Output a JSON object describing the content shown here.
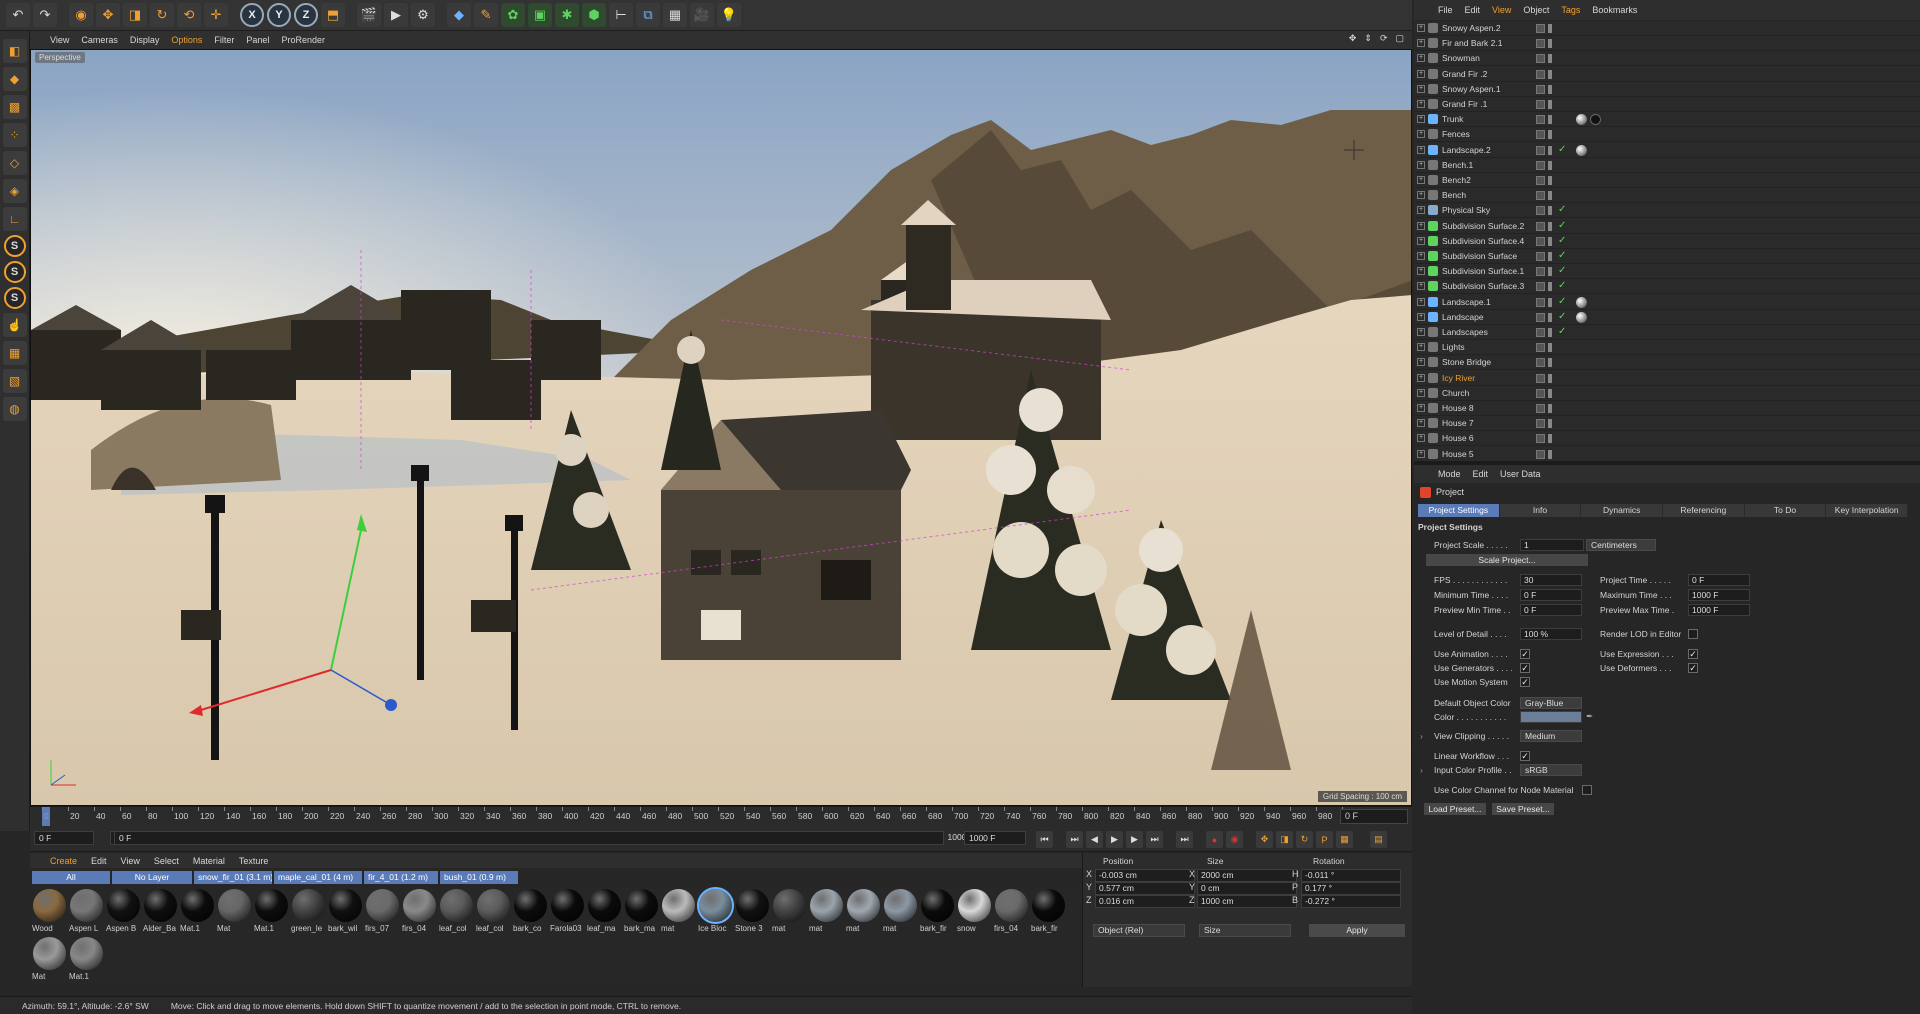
{
  "top_menu": {
    "file": "File",
    "edit": "Edit",
    "view": "View",
    "object": "Object",
    "tags": "Tags",
    "bookmarks": "Bookmarks"
  },
  "toolbar": {
    "x_axis": "X",
    "y_axis": "Y",
    "z_axis": "Z"
  },
  "viewport": {
    "menu": {
      "view": "View",
      "cameras": "Cameras",
      "display": "Display",
      "options": "Options",
      "filter": "Filter",
      "panel": "Panel",
      "prorender": "ProRender"
    },
    "label": "Perspective",
    "grid_spacing": "Grid Spacing : 100 cm"
  },
  "timeline": {
    "ticks": [
      "0",
      "20",
      "40",
      "60",
      "80",
      "100",
      "120",
      "140",
      "160",
      "180",
      "200",
      "220",
      "240",
      "260",
      "280",
      "300",
      "320",
      "340",
      "360",
      "380",
      "400",
      "420",
      "440",
      "460",
      "480",
      "500",
      "520",
      "540",
      "560",
      "580",
      "600",
      "620",
      "640",
      "660",
      "680",
      "700",
      "720",
      "740",
      "760",
      "780",
      "800",
      "820",
      "840",
      "860",
      "880",
      "900",
      "920",
      "940",
      "960",
      "980",
      "1000"
    ],
    "current_frame": "0 F",
    "start": "0 F",
    "start2": "0 F",
    "end": "1000 F",
    "end2": "1000 F"
  },
  "material_manager": {
    "menu": {
      "create": "Create",
      "edit": "Edit",
      "view": "View",
      "select": "Select",
      "material": "Material",
      "texture": "Texture"
    },
    "layers": [
      "All",
      "No Layer",
      "snow_fir_01 (3.1 m)",
      "maple_cal_01 (4 m)",
      "fir_4_01 (1.2 m)",
      "bush_01 (0.9 m)"
    ],
    "materials": [
      {
        "name": "Wood",
        "color": "#8a6a40"
      },
      {
        "name": "Aspen L",
        "color": "#777"
      },
      {
        "name": "Aspen B",
        "color": "#111"
      },
      {
        "name": "Alder_Ba",
        "color": "#0e0e0e"
      },
      {
        "name": "Mat.1",
        "color": "#0c0c0c"
      },
      {
        "name": "Mat",
        "color": "#666"
      },
      {
        "name": "Mat.1",
        "color": "#0d0d0d"
      },
      {
        "name": "green_le",
        "color": "#444"
      },
      {
        "name": "bark_wil",
        "color": "#101010"
      },
      {
        "name": "firs_07",
        "color": "#6a6a6a"
      },
      {
        "name": "firs_04",
        "color": "#8a8a8a"
      },
      {
        "name": "leaf_col",
        "color": "#5a5a5a"
      },
      {
        "name": "leaf_col",
        "color": "#5c5c5c"
      },
      {
        "name": "bark_co",
        "color": "#0c0c0c"
      },
      {
        "name": "Farola03",
        "color": "#0a0a0a"
      },
      {
        "name": "leaf_ma",
        "color": "#0b0b0b"
      },
      {
        "name": "bark_ma",
        "color": "#0c0c0c"
      },
      {
        "name": "mat",
        "color": "#bbbbbb"
      },
      {
        "name": "Ice Bloc",
        "color": "#7a8e9e"
      },
      {
        "name": "Stone 3",
        "color": "#111"
      },
      {
        "name": "mat",
        "color": "#444"
      },
      {
        "name": "mat",
        "color": "#9aa4ac"
      },
      {
        "name": "mat",
        "color": "#a0a8b0"
      },
      {
        "name": "mat",
        "color": "#8c98a4"
      },
      {
        "name": "bark_fir",
        "color": "#0b0b0b"
      },
      {
        "name": "snow",
        "color": "#d8d8d8"
      },
      {
        "name": "firs_04",
        "color": "#6a6a6a"
      },
      {
        "name": "bark_fir",
        "color": "#0a0a0a"
      },
      {
        "name": "Mat",
        "color": "#9a9a9a"
      },
      {
        "name": "Mat.1",
        "color": "#888"
      }
    ]
  },
  "coordinates": {
    "headers": {
      "position": "Position",
      "size": "Size",
      "rotation": "Rotation"
    },
    "rows": [
      {
        "axis": "X",
        "pos": "-0.003 cm",
        "size_axis": "X",
        "size": "2000 cm",
        "rot_axis": "H",
        "rot": "-0.011 °"
      },
      {
        "axis": "Y",
        "pos": "0.577 cm",
        "size_axis": "Y",
        "size": "0 cm",
        "rot_axis": "P",
        "rot": "0.177 °"
      },
      {
        "axis": "Z",
        "pos": "0.016 cm",
        "size_axis": "Z",
        "size": "1000 cm",
        "rot_axis": "B",
        "rot": "-0.272 °"
      }
    ],
    "mode": "Object (Rel)",
    "size_mode": "Size",
    "apply": "Apply"
  },
  "status": {
    "azimuth": "Azimuth: 59.1°, Altitude: -2.6°  SW",
    "message": "Move: Click and drag to move elements. Hold down SHIFT to quantize movement / add to the selection in point mode, CTRL to remove."
  },
  "objects": [
    {
      "name": "Snowy Aspen.2",
      "color": "#d4d4d4",
      "icon": "#777"
    },
    {
      "name": "Fir and Bark 2.1",
      "color": "#d4d4d4",
      "icon": "#777"
    },
    {
      "name": "Snowman",
      "color": "#d4d4d4",
      "icon": "#777"
    },
    {
      "name": "Grand Fir .2",
      "color": "#d4d4d4",
      "icon": "#777"
    },
    {
      "name": "Snowy Aspen.1",
      "color": "#d4d4d4",
      "icon": "#777"
    },
    {
      "name": "Grand Fir .1",
      "color": "#d4d4d4",
      "icon": "#777"
    },
    {
      "name": "Trunk",
      "color": "#d4d4d4",
      "icon": "#6cb4ff"
    },
    {
      "name": "Fences",
      "color": "#d4d4d4",
      "icon": "#777"
    },
    {
      "name": "Landscape.2",
      "color": "#d4d4d4",
      "icon": "#6cb4ff"
    },
    {
      "name": "Bench.1",
      "color": "#d4d4d4",
      "icon": "#777"
    },
    {
      "name": "Bench2",
      "color": "#d4d4d4",
      "icon": "#777"
    },
    {
      "name": "Bench",
      "color": "#d4d4d4",
      "icon": "#777"
    },
    {
      "name": "Physical Sky",
      "color": "#d4d4d4",
      "icon": "#8ac"
    },
    {
      "name": "Subdivision Surface.2",
      "color": "#d4d4d4",
      "icon": "#5fd35f"
    },
    {
      "name": "Subdivision Surface.4",
      "color": "#d4d4d4",
      "icon": "#5fd35f"
    },
    {
      "name": "Subdivision Surface",
      "color": "#d4d4d4",
      "icon": "#5fd35f"
    },
    {
      "name": "Subdivision Surface.1",
      "color": "#d4d4d4",
      "icon": "#5fd35f"
    },
    {
      "name": "Subdivision Surface.3",
      "color": "#d4d4d4",
      "icon": "#5fd35f"
    },
    {
      "name": "Landscape.1",
      "color": "#d4d4d4",
      "icon": "#6cb4ff"
    },
    {
      "name": "Landscape",
      "color": "#d4d4d4",
      "icon": "#6cb4ff"
    },
    {
      "name": "Landscapes",
      "color": "#d4d4d4",
      "icon": "#777"
    },
    {
      "name": "Lights",
      "color": "#d4d4d4",
      "icon": "#777"
    },
    {
      "name": "Stone Bridge",
      "color": "#d4d4d4",
      "icon": "#777"
    },
    {
      "name": "Icy River",
      "color": "#f0a030",
      "icon": "#777"
    },
    {
      "name": "Church",
      "color": "#d4d4d4",
      "icon": "#777"
    },
    {
      "name": "House 8",
      "color": "#d4d4d4",
      "icon": "#777"
    },
    {
      "name": "House 7",
      "color": "#d4d4d4",
      "icon": "#777"
    },
    {
      "name": "House 6",
      "color": "#d4d4d4",
      "icon": "#777"
    },
    {
      "name": "House 5",
      "color": "#d4d4d4",
      "icon": "#777"
    }
  ],
  "attributes": {
    "menu": {
      "mode": "Mode",
      "edit": "Edit",
      "user_data": "User Data"
    },
    "title": "Project",
    "tabs": [
      "Project Settings",
      "Info",
      "Dynamics",
      "Referencing",
      "To Do",
      "Key Interpolation"
    ],
    "section": "Project Settings",
    "project_scale_label": "Project Scale . . . . .",
    "project_scale": "1",
    "scale_unit": "Centimeters",
    "scale_project": "Scale Project...",
    "fps_label": "FPS . . . . . . . . . . . .",
    "fps": "30",
    "project_time_label": "Project Time . . . . .",
    "project_time": "0 F",
    "min_time_label": "Minimum Time . . . .",
    "min_time": "0 F",
    "max_time_label": "Maximum Time . . .",
    "max_time": "1000 F",
    "prev_min_label": "Preview Min Time . .",
    "prev_min": "0 F",
    "prev_max_label": "Preview Max Time .",
    "prev_max": "1000 F",
    "lod_label": "Level of Detail . . . .",
    "lod": "100 %",
    "render_lod_label": "Render LOD in Editor",
    "use_animation": "Use Animation . . . .",
    "use_expression": "Use Expression . . .",
    "use_generators": "Use Generators . . . .",
    "use_deformers": "Use Deformers . . .",
    "use_motion": "Use Motion System",
    "default_color_label": "Default Object Color",
    "default_color": "Gray-Blue",
    "color_label": "Color . . . . . . . . . . .",
    "view_clipping_label": "View Clipping . . . . .",
    "view_clipping": "Medium",
    "linear_workflow": "Linear Workflow . . .",
    "input_profile_label": "Input Color Profile . .",
    "input_profile": "sRGB",
    "color_channel": "Use Color Channel for Node Material",
    "load_preset": "Load Preset...",
    "save_preset": "Save Preset..."
  }
}
